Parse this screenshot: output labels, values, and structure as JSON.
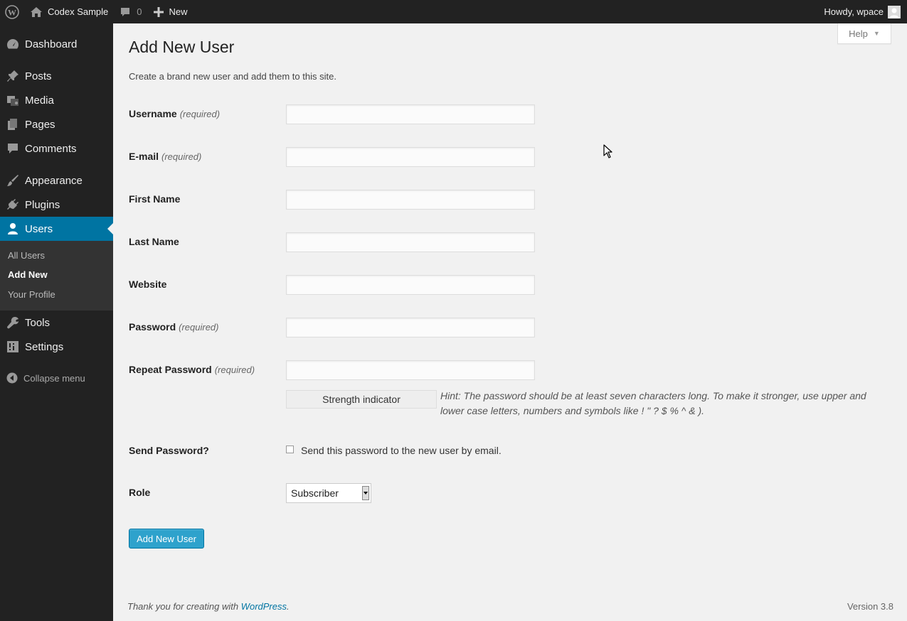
{
  "admin_bar": {
    "site_name": "Codex Sample",
    "comments_count": "0",
    "new_label": "New",
    "account_label": "Howdy, wpace"
  },
  "sidebar": {
    "items": [
      {
        "label": "Dashboard",
        "icon": "dashboard-icon"
      },
      {
        "label": "Posts",
        "icon": "pin-icon"
      },
      {
        "label": "Media",
        "icon": "media-icon"
      },
      {
        "label": "Pages",
        "icon": "pages-icon"
      },
      {
        "label": "Comments",
        "icon": "comment-icon"
      },
      {
        "label": "Appearance",
        "icon": "brush-icon"
      },
      {
        "label": "Plugins",
        "icon": "plug-icon"
      },
      {
        "label": "Users",
        "icon": "user-icon",
        "active": true
      },
      {
        "label": "Tools",
        "icon": "wrench-icon"
      },
      {
        "label": "Settings",
        "icon": "settings-icon"
      }
    ],
    "users_submenu": [
      "All Users",
      "Add New",
      "Your Profile"
    ],
    "current_submenu": "Add New",
    "collapse_label": "Collapse menu"
  },
  "help_label": "Help",
  "page": {
    "title": "Add New User",
    "intro": "Create a brand new user and add them to this site."
  },
  "form": {
    "required_text": "(required)",
    "fields": [
      {
        "label": "Username",
        "required": true,
        "value": ""
      },
      {
        "label": "E-mail",
        "required": true,
        "value": ""
      },
      {
        "label": "First Name",
        "required": false,
        "value": ""
      },
      {
        "label": "Last Name",
        "required": false,
        "value": ""
      },
      {
        "label": "Website",
        "required": false,
        "value": ""
      },
      {
        "label": "Password",
        "required": true,
        "value": ""
      },
      {
        "label": "Repeat Password",
        "required": true,
        "value": ""
      }
    ],
    "strength_indicator": "Strength indicator",
    "hint_line1": "Hint: The password should be at least seven characters long. To make it stronger, use upper and",
    "hint_line2": "lower case letters, numbers and symbols like ! \" ? $ % ^ & ).",
    "send_password_label": "Send Password?",
    "send_password_text": "Send this password to the new user by email.",
    "send_password_checked": false,
    "role_label": "Role",
    "role_value": "Subscriber",
    "submit_label": "Add New User"
  },
  "footer": {
    "thanks_prefix": "Thank you for creating with ",
    "thanks_link": "WordPress",
    "thanks_suffix": ".",
    "version": "Version 3.8"
  },
  "colors": {
    "admin_bar_bg": "#222222",
    "sidebar_bg": "#222222",
    "active_menu_bg": "#0074a2",
    "primary_button": "#2ea2cc",
    "content_bg": "#f1f1f1"
  }
}
